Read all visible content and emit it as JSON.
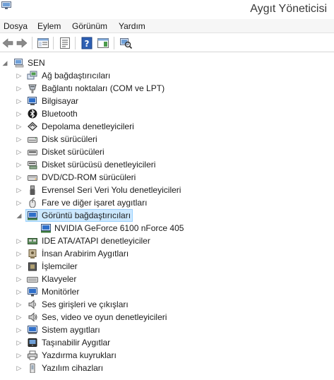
{
  "window": {
    "title": "Aygıt Yöneticisi"
  },
  "menu": {
    "items": [
      "Dosya",
      "Eylem",
      "Görünüm",
      "Yardım"
    ]
  },
  "tree": {
    "root": "SEN",
    "categories": [
      {
        "label": "Ağ bağdaştırıcıları",
        "icon": "network-adapter-icon"
      },
      {
        "label": "Bağlantı noktaları (COM ve LPT)",
        "icon": "port-icon"
      },
      {
        "label": "Bilgisayar",
        "icon": "computer-icon"
      },
      {
        "label": "Bluetooth",
        "icon": "bluetooth-icon"
      },
      {
        "label": "Depolama denetleyicileri",
        "icon": "storage-controller-icon"
      },
      {
        "label": "Disk sürücüleri",
        "icon": "disk-drive-icon"
      },
      {
        "label": "Disket sürücüleri",
        "icon": "floppy-drive-icon"
      },
      {
        "label": "Disket sürücüsü denetleyicileri",
        "icon": "floppy-controller-icon"
      },
      {
        "label": "DVD/CD-ROM sürücüleri",
        "icon": "dvd-drive-icon"
      },
      {
        "label": "Evrensel Seri Veri Yolu denetleyicileri",
        "icon": "usb-icon"
      },
      {
        "label": "Fare ve diğer işaret aygıtları",
        "icon": "mouse-icon"
      },
      {
        "label": "Görüntü bağdaştırıcıları",
        "icon": "display-adapter-icon",
        "expanded": true,
        "selected": true,
        "children": [
          {
            "label": "NVIDIA GeForce 6100 nForce 405",
            "icon": "gpu-icon"
          }
        ]
      },
      {
        "label": "IDE ATA/ATAPI denetleyiciler",
        "icon": "ide-controller-icon"
      },
      {
        "label": "İnsan Arabirim Aygıtları",
        "icon": "hid-icon"
      },
      {
        "label": "İşlemciler",
        "icon": "processor-icon"
      },
      {
        "label": "Klavyeler",
        "icon": "keyboard-icon"
      },
      {
        "label": "Monitörler",
        "icon": "monitor-icon"
      },
      {
        "label": "Ses girişleri ve çıkışları",
        "icon": "audio-io-icon"
      },
      {
        "label": "Ses, video ve oyun denetleyicileri",
        "icon": "sound-icon"
      },
      {
        "label": "Sistem aygıtları",
        "icon": "system-device-icon"
      },
      {
        "label": "Taşınabilir Aygıtlar",
        "icon": "portable-device-icon"
      },
      {
        "label": "Yazdırma kuyrukları",
        "icon": "printer-icon"
      },
      {
        "label": "Yazılım cihazları",
        "icon": "software-device-icon"
      }
    ]
  },
  "colors": {
    "selection": "#cce8ff",
    "selection_border": "#99d1ff",
    "accent": "#2b6bc6"
  }
}
